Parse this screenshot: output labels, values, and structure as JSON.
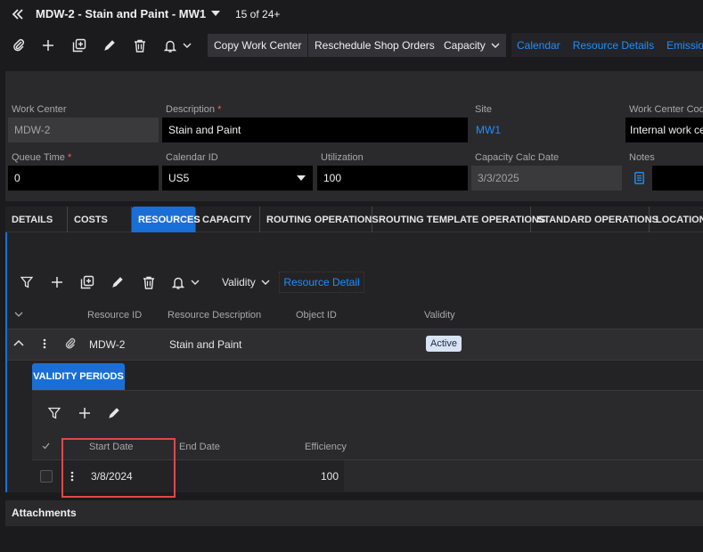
{
  "header": {
    "back_icon": "double-chevron-left-icon",
    "title": "MDW-2 - Stain and Paint - MW1",
    "counter": "15 of 24+"
  },
  "toolbar": {
    "copy_work_center": "Copy Work Center",
    "reschedule": "Reschedule Shop Orders",
    "capacity": "Capacity",
    "links": [
      "Calendar",
      "Resource Details",
      "Emissions"
    ]
  },
  "form": {
    "work_center_label": "Work Center",
    "work_center_value": "MDW-2",
    "description_label": "Description",
    "description_value": "Stain and Paint",
    "site_label": "Site",
    "site_value": "MW1",
    "wc_code_label": "Work Center Code",
    "wc_code_value": "Internal work ce",
    "queue_time_label": "Queue Time",
    "queue_time_value": "0",
    "calendar_label": "Calendar ID",
    "calendar_value": "US5",
    "utilization_label": "Utilization",
    "utilization_value": "100",
    "capacity_calc_label": "Capacity Calc Date",
    "capacity_calc_value": "3/3/2025",
    "notes_label": "Notes",
    "required_mark": "*"
  },
  "tabs": [
    "DETAILS",
    "COSTS",
    "RESOURCES",
    "CAPACITY",
    "ROUTING OPERATIONS",
    "ROUTING TEMPLATE OPERATIONS",
    "STANDARD OPERATIONS",
    "LOCATIONS"
  ],
  "resources": {
    "validity_button": "Validity",
    "resource_detail_link": "Resource Detail",
    "columns": [
      "Resource ID",
      "Resource Description",
      "Object ID",
      "Validity"
    ],
    "row": {
      "resource_id": "MDW-2",
      "description": "Stain and Paint",
      "object_id": "",
      "validity": "Active"
    }
  },
  "validity_periods": {
    "tab_label": "VALIDITY PERIODS",
    "columns": [
      "Start Date",
      "End Date",
      "Efficiency"
    ],
    "row": {
      "start_date": "3/8/2024",
      "end_date": "",
      "efficiency": "100"
    }
  },
  "attachments": {
    "label": "Attachments"
  },
  "colors": {
    "accent": "#1a6fd6",
    "link": "#1e8fff",
    "highlight": "#e0474c"
  }
}
